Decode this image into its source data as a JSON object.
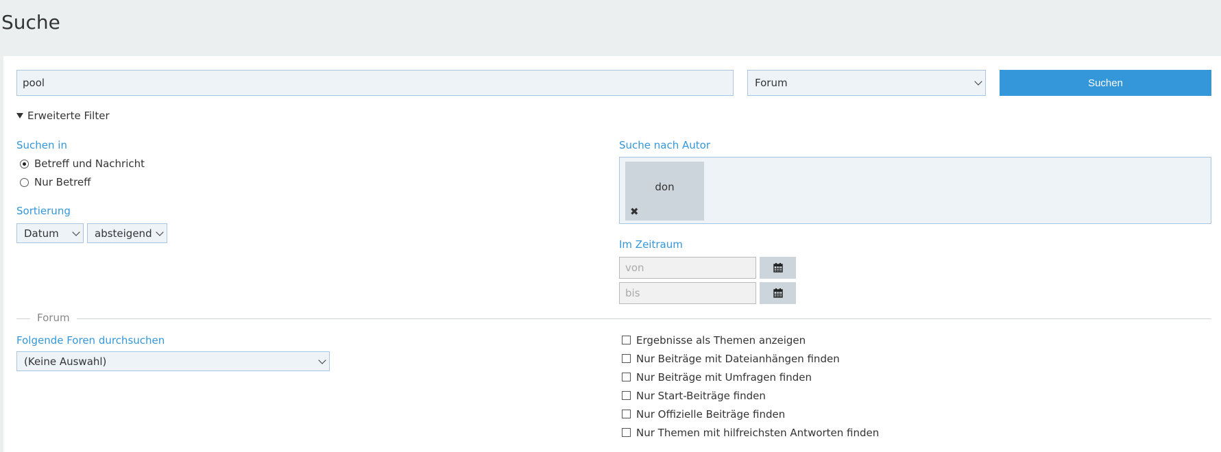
{
  "page": {
    "title": "Suche"
  },
  "search": {
    "query": "pool",
    "scope": "Forum",
    "button_label": "Suchen"
  },
  "advanced": {
    "toggle_label": "Erweiterte Filter",
    "search_in": {
      "label": "Suchen in",
      "options": [
        {
          "label": "Betreff und Nachricht",
          "checked": true
        },
        {
          "label": "Nur Betreff",
          "checked": false
        }
      ]
    },
    "sorting": {
      "label": "Sortierung",
      "field": "Datum",
      "order": "absteigend"
    },
    "author": {
      "label": "Suche nach Autor",
      "chips": [
        {
          "name": "don",
          "remove_icon": "close-icon"
        }
      ]
    },
    "period": {
      "label": "Im Zeitraum",
      "from_placeholder": "von",
      "to_placeholder": "bis",
      "icon": "calendar-icon"
    }
  },
  "forum_section": {
    "legend": "Forum",
    "forums_label": "Folgende Foren durchsuchen",
    "forums_selected": "(Keine Auswahl)",
    "checkboxes": [
      {
        "label": "Ergebnisse als Themen anzeigen",
        "checked": false
      },
      {
        "label": "Nur Beiträge mit Dateianhängen finden",
        "checked": false
      },
      {
        "label": "Nur Beiträge mit Umfragen finden",
        "checked": false
      },
      {
        "label": "Nur Start-Beiträge finden",
        "checked": false
      },
      {
        "label": "Nur Offizielle Beiträge finden",
        "checked": false
      },
      {
        "label": "Nur Themen mit hilfreichsten Antworten finden",
        "checked": false
      }
    ]
  },
  "colors": {
    "accent": "#3497da",
    "field_bg": "#eef3f8",
    "field_border": "#a8c6e2",
    "header_bg": "#eceff0"
  }
}
